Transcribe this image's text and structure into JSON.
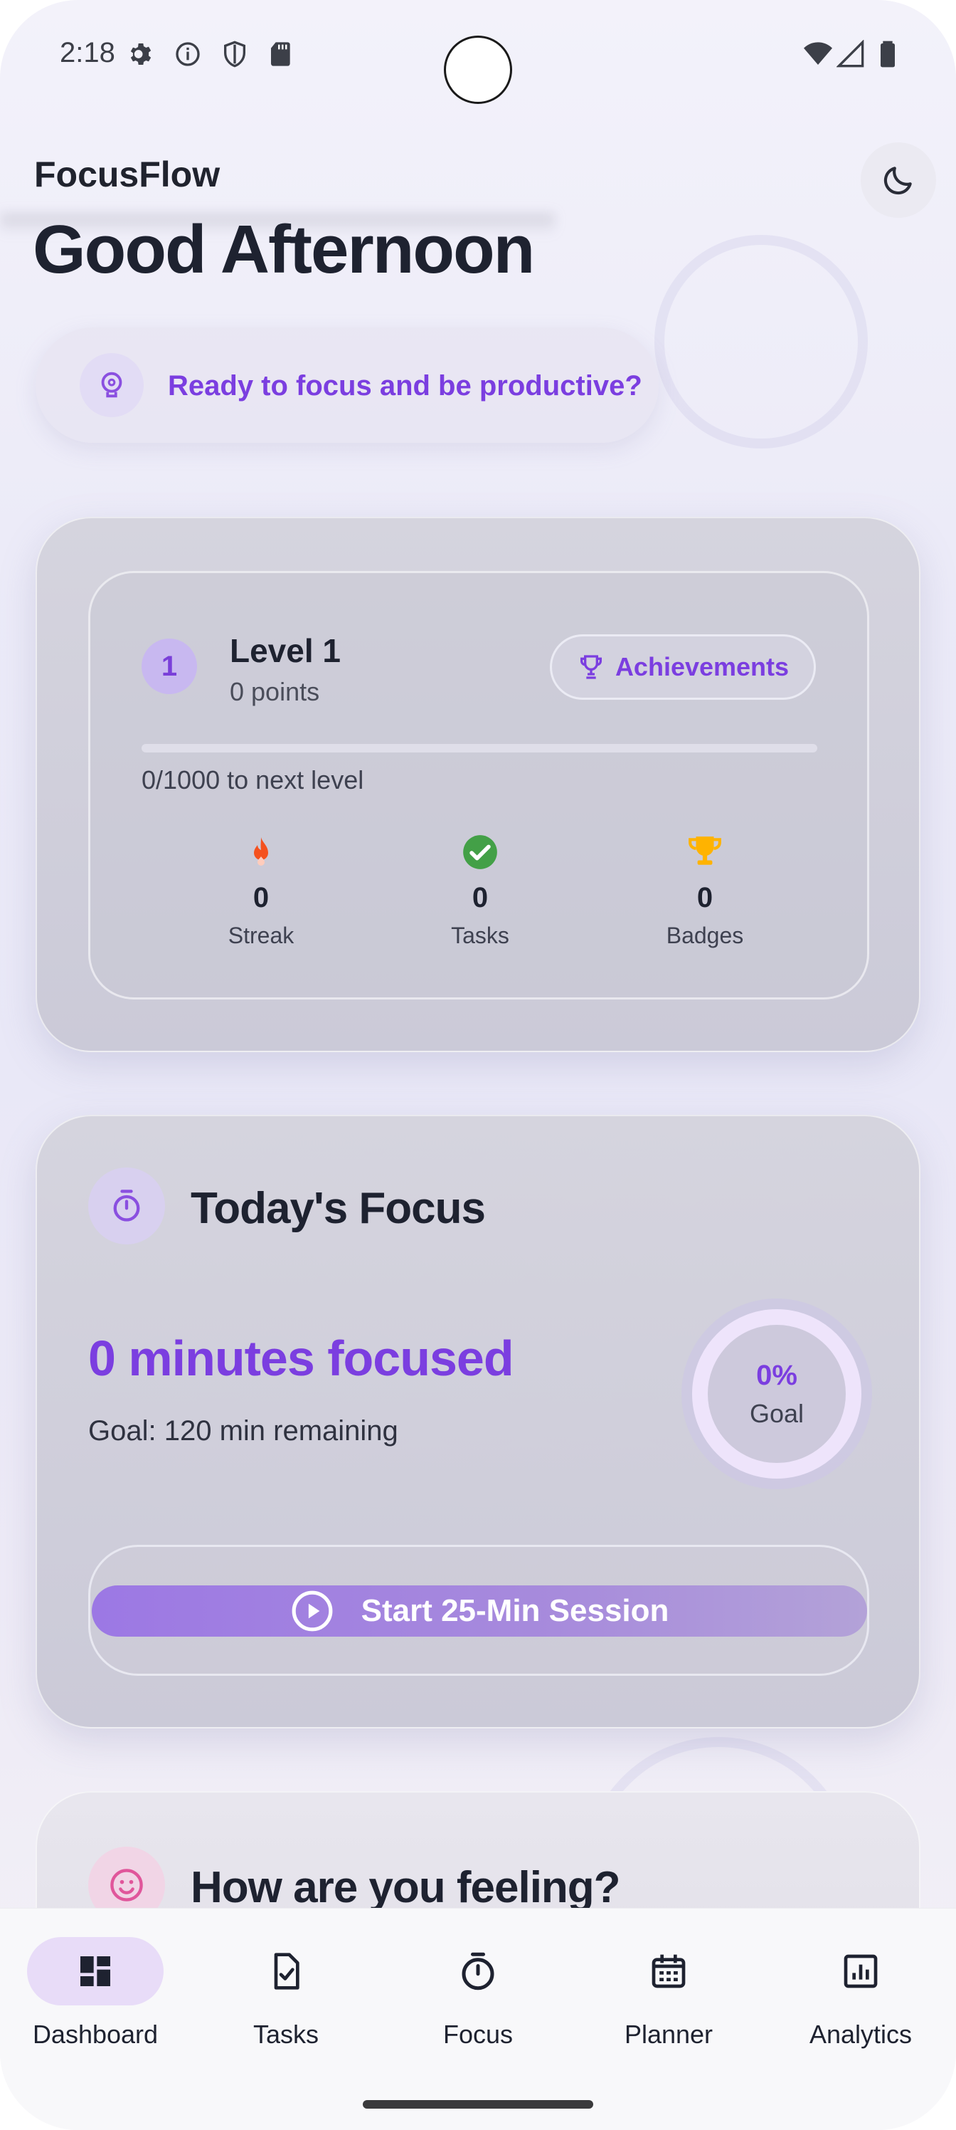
{
  "status_bar": {
    "time": "2:18",
    "left_icons": [
      "gear-icon",
      "info-icon",
      "shield-icon",
      "sd-card-icon"
    ],
    "right_icons": [
      "wifi-icon",
      "signal-icon",
      "battery-icon"
    ]
  },
  "app_bar": {
    "title": "FocusFlow",
    "theme_toggle_icon": "moon-icon"
  },
  "greeting": "Good Afternoon",
  "motto": {
    "icon": "brain-bulb-icon",
    "text": "Ready to focus and be productive?"
  },
  "level_card": {
    "level_number": "1",
    "level_title": "Level 1",
    "points": "0 points",
    "achievements_label": "Achievements",
    "progress_text": "0/1000 to next level",
    "progress_fraction": 0,
    "stats": [
      {
        "icon": "fire-icon",
        "value": "0",
        "label": "Streak",
        "color": "#f4511e"
      },
      {
        "icon": "check-circle-icon",
        "value": "0",
        "label": "Tasks",
        "color": "#43a047"
      },
      {
        "icon": "trophy-icon",
        "value": "0",
        "label": "Badges",
        "color": "#ffb300"
      }
    ]
  },
  "focus_card": {
    "title": "Today's Focus",
    "minutes_text": "0 minutes focused",
    "goal_text": "Goal: 120 min remaining",
    "ring_percent": "0%",
    "ring_label": "Goal",
    "session_button": "Start 25-Min Session"
  },
  "mood_card": {
    "title": "How are you feeling?"
  },
  "bottom_nav": [
    {
      "label": "Dashboard",
      "icon": "dashboard-icon",
      "active": true
    },
    {
      "label": "Tasks",
      "icon": "task-check-icon",
      "active": false
    },
    {
      "label": "Focus",
      "icon": "timer-icon",
      "active": false
    },
    {
      "label": "Planner",
      "icon": "calendar-icon",
      "active": false
    },
    {
      "label": "Analytics",
      "icon": "analytics-icon",
      "active": false
    }
  ],
  "colors": {
    "accent": "#7b3ee0",
    "text_primary": "#1e2230"
  }
}
